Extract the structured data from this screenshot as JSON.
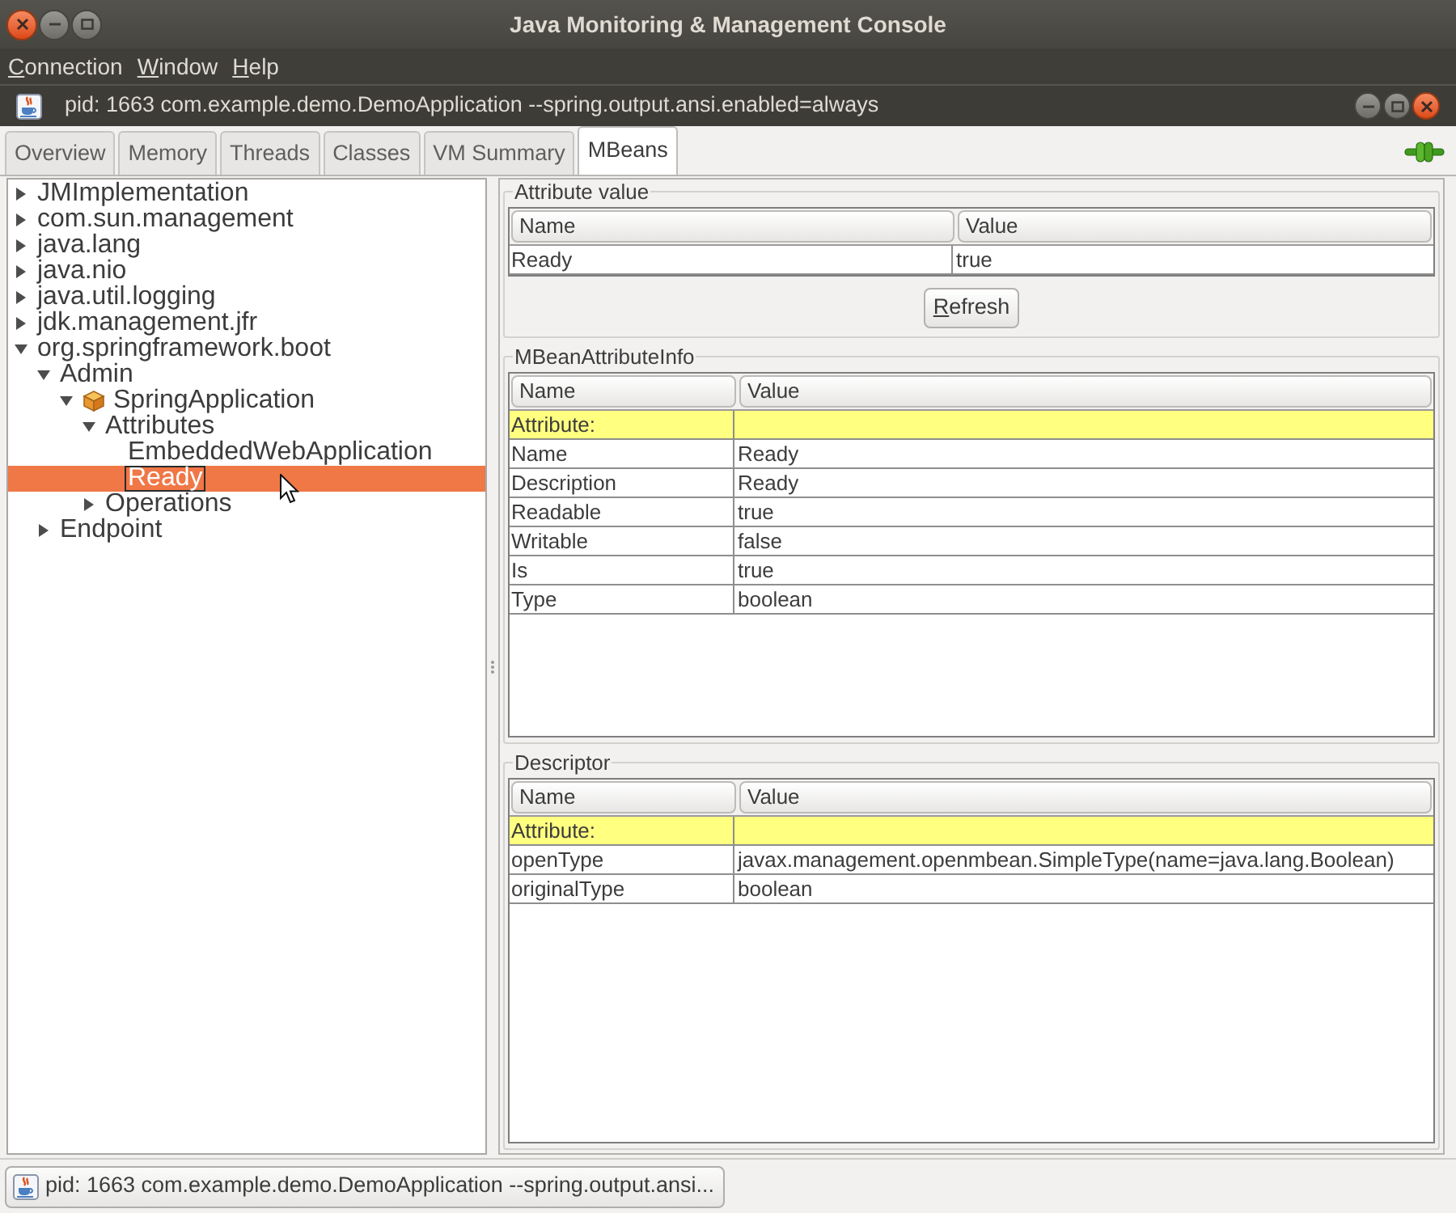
{
  "window": {
    "title": "Java Monitoring & Management Console"
  },
  "menu_bar": [
    "Connection",
    "Window",
    "Help"
  ],
  "internal_frame": {
    "title": "pid: 1663 com.example.demo.DemoApplication --spring.output.ansi.enabled=always"
  },
  "tabs": [
    {
      "label": "Overview",
      "selected": false
    },
    {
      "label": "Memory",
      "selected": false
    },
    {
      "label": "Threads",
      "selected": false
    },
    {
      "label": "Classes",
      "selected": false
    },
    {
      "label": "VM Summary",
      "selected": false
    },
    {
      "label": "MBeans",
      "selected": true
    }
  ],
  "mbean_tree": [
    {
      "label": "JMImplementation",
      "kind": "folder",
      "expanded": false,
      "selected": false
    },
    {
      "label": "com.sun.management",
      "kind": "folder",
      "expanded": false,
      "selected": false
    },
    {
      "label": "java.lang",
      "kind": "folder",
      "expanded": false,
      "selected": false
    },
    {
      "label": "java.nio",
      "kind": "folder",
      "expanded": false,
      "selected": false
    },
    {
      "label": "java.util.logging",
      "kind": "folder",
      "expanded": false,
      "selected": false
    },
    {
      "label": "jdk.management.jfr",
      "kind": "folder",
      "expanded": false,
      "selected": false
    },
    {
      "label": "org.springframework.boot",
      "kind": "folder",
      "expanded": true,
      "selected": false,
      "children": [
        {
          "label": "Admin",
          "kind": "folder",
          "expanded": true,
          "selected": false,
          "children": [
            {
              "label": "SpringApplication",
              "kind": "mbean",
              "expanded": true,
              "selected": false,
              "children": [
                {
                  "label": "Attributes",
                  "kind": "folder",
                  "expanded": true,
                  "selected": false,
                  "children": [
                    {
                      "label": "EmbeddedWebApplication",
                      "kind": "leaf",
                      "selected": false
                    },
                    {
                      "label": "Ready",
                      "kind": "leaf",
                      "selected": true
                    }
                  ]
                },
                {
                  "label": "Operations",
                  "kind": "folder",
                  "expanded": false,
                  "selected": false
                }
              ]
            }
          ]
        },
        {
          "label": "Endpoint",
          "kind": "folder",
          "expanded": false,
          "selected": false
        }
      ]
    }
  ],
  "attribute_value": {
    "title": "Attribute value",
    "columns": [
      "Name",
      "Value"
    ],
    "rows": [
      {
        "name": "Ready",
        "value": "true"
      }
    ],
    "refresh_button": "Refresh"
  },
  "attribute_info": {
    "title": "MBeanAttributeInfo",
    "columns": [
      "Name",
      "Value"
    ],
    "rows": [
      {
        "kind": "section",
        "name": "Attribute:"
      },
      {
        "kind": "entry",
        "name": "Name",
        "value": "Ready"
      },
      {
        "kind": "entry",
        "name": "Description",
        "value": "Ready"
      },
      {
        "kind": "entry",
        "name": "Readable",
        "value": "true"
      },
      {
        "kind": "entry",
        "name": "Writable",
        "value": "false"
      },
      {
        "kind": "entry",
        "name": "Is",
        "value": "true"
      },
      {
        "kind": "entry",
        "name": "Type",
        "value": "boolean"
      }
    ]
  },
  "descriptor": {
    "title": "Descriptor",
    "columns": [
      "Name",
      "Value"
    ],
    "rows": [
      {
        "kind": "section",
        "name": "Attribute:"
      },
      {
        "kind": "entry",
        "name": "openType",
        "value": "javax.management.openmbean.SimpleType(name=java.lang.Boolean)"
      },
      {
        "kind": "entry",
        "name": "originalType",
        "value": "boolean"
      }
    ]
  },
  "taskbar": [
    {
      "label": "pid: 1663 com.example.demo.DemoApplication --spring.output.ansi..."
    }
  ]
}
